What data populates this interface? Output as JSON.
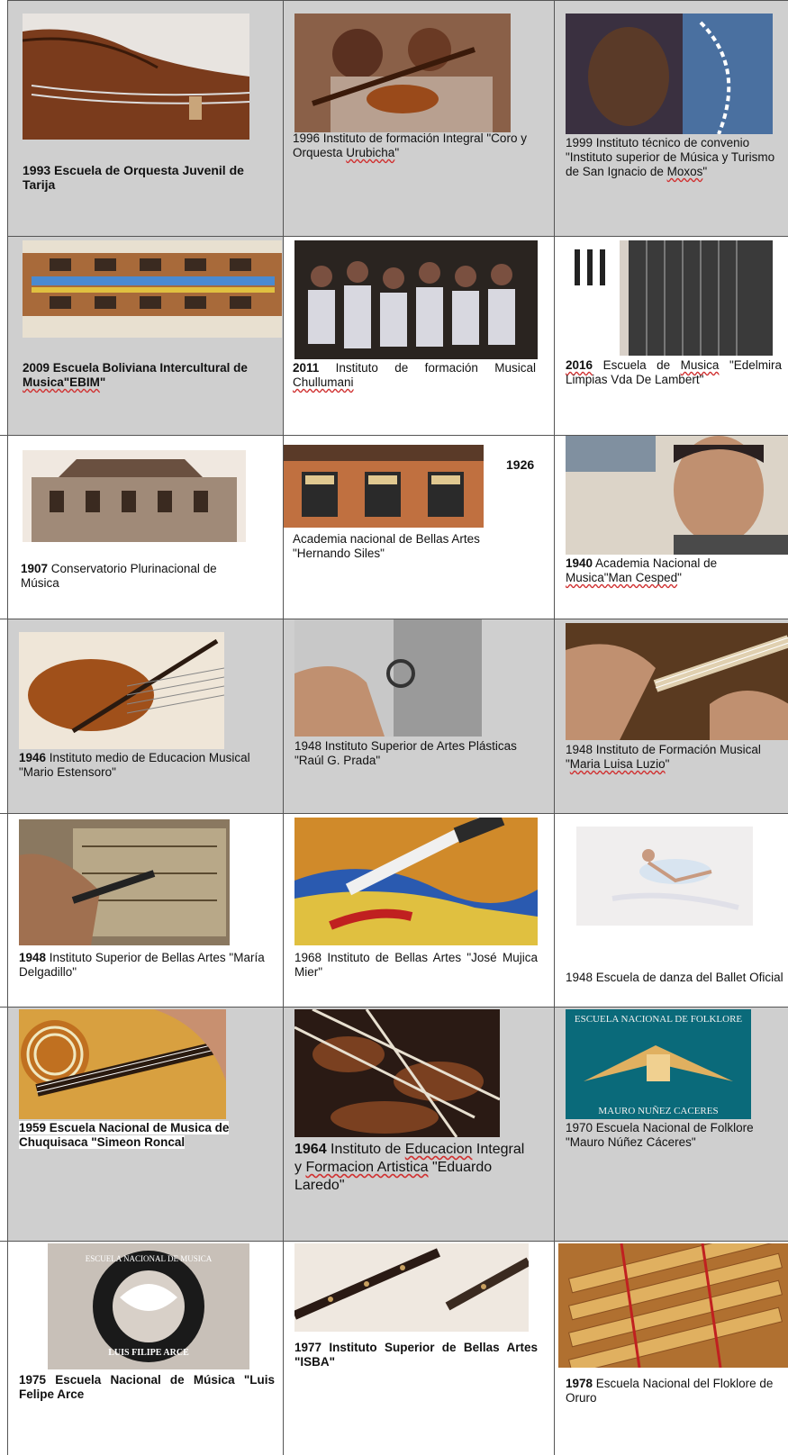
{
  "rows": [
    {
      "cells": [
        {
          "year": "1993",
          "text": " Escuela de Orquesta Juvenil de Tarija",
          "icon": "double-bass-photo"
        },
        {
          "year": "1996",
          "text": " Instituto de formación Integral \"Coro y Orquesta ",
          "wavy": "Urubicha",
          "tail": "\"",
          "icon": "children-violin-photo"
        },
        {
          "year": "1999",
          "text": " Instituto técnico de convenio \"Instituto superior de Música y Turismo de San Ignacio de ",
          "wavy": "Moxos",
          "tail": "\"",
          "icon": "child-portrait-photo"
        }
      ]
    },
    {
      "cells": [
        {
          "year": "2009",
          "text": " Escuela Boliviana Intercultural de ",
          "wavy": "Musica\"EBIM",
          "tail": "\"",
          "icon": "school-building-photo"
        },
        {
          "year": "2011",
          "text": " Instituto de formación Musical ",
          "wavy": "Chullumani",
          "tail": "",
          "icon": "children-group-photo"
        },
        {
          "year": "2016",
          "text": " Escuela de ",
          "wavy": "Musica",
          "tail": " \"Edelmira Limpias Vda De Lambert\"",
          "icon": "accordion-photo"
        }
      ]
    },
    {
      "cells": [
        {
          "year": "1907",
          "text": " Conservatorio Plurinacional de Música",
          "icon": "conservatory-building-photo"
        },
        {
          "year": "1926",
          "text": "Academia nacional de Bellas Artes \"Hernando Siles\"",
          "icon": "academy-building-photo"
        },
        {
          "year": "1940",
          "text": "  Academia Nacional de ",
          "wavy": "Musica\"Man Cesped",
          "tail": "\"",
          "icon": "musician-portrait-photo"
        }
      ]
    },
    {
      "cells": [
        {
          "year": "1946",
          "text": " Instituto medio de Educacion Musical \"Mario Estensoro\"",
          "icon": "violin-sheet-photo"
        },
        {
          "year": "1948",
          "text": " Instituto Superior de Artes Plásticas \"Raúl G. Prada\"",
          "icon": "sculpting-hand-photo"
        },
        {
          "year": "1948",
          "text": " Instituto de Formación Musical \"",
          "wavy": "Maria Luisa Luzio",
          "tail": "\"",
          "icon": "guitar-playing-photo"
        }
      ]
    },
    {
      "cells": [
        {
          "year": "1948",
          "text": " Instituto Superior de Bellas Artes \"María Delgadillo\"",
          "icon": "engraving-photo"
        },
        {
          "year": "1968",
          "text": " Instituto de Bellas Artes \"José Mujica Mier\"",
          "icon": "paintbrush-photo"
        },
        {
          "year": "1948",
          "text": " Escuela de danza del Ballet Oficial",
          "icon": "ballerina-photo"
        }
      ]
    },
    {
      "cells": [
        {
          "year": "1959",
          "text": " Escuela Nacional de Musica de Chuquisaca \"Simeon Roncal",
          "icon": "charango-photo"
        },
        {
          "year": "1964",
          "text": " Instituto de ",
          "wavy": "Educacion",
          "mid": " Integral y ",
          "wavy2": "Formacion Artistica",
          "tail": " \"Eduardo Laredo\"",
          "icon": "orchestra-photo"
        },
        {
          "year": "1970",
          "text": " Escuela Nacional de Folklore \"Mauro Núñez Cáceres\"",
          "icon": "folklore-logo",
          "logo_top": "ESCUELA NACIONAL DE FOLKLORE",
          "logo_bottom": "MAURO NUÑEZ CACERES"
        }
      ]
    },
    {
      "cells": [
        {
          "year": "1975",
          "text": " Escuela Nacional de Música \"Luis Felipe Arce",
          "icon": "music-school-seal",
          "logo_ring": "ESCUELA NACIONAL DE MUSICA",
          "logo_name": "LUIS FILIPE ARCE"
        },
        {
          "year": "1977",
          "text": " Instituto Superior de Bellas Artes \"ISBA\"",
          "icon": "flutes-photo"
        },
        {
          "year": "1978",
          "text": " Escuela Nacional del Floklore de Oruro",
          "icon": "panpipes-photo"
        }
      ]
    }
  ]
}
